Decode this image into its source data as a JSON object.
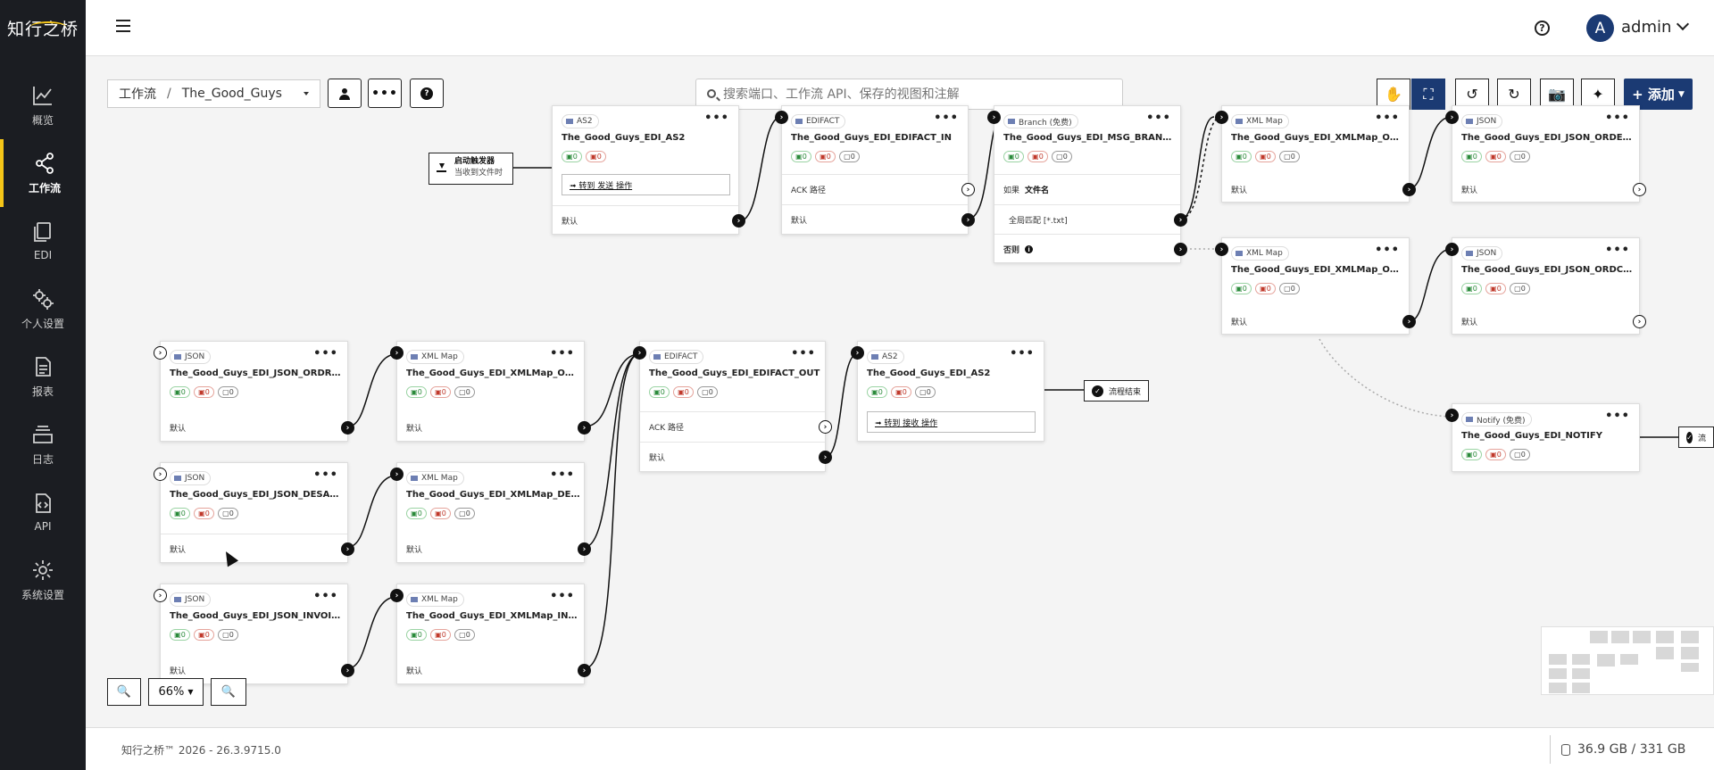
{
  "app": {
    "logo_text": "知行之桥"
  },
  "sidebar": {
    "items": [
      {
        "label": "概览",
        "icon": "chart-line-icon"
      },
      {
        "label": "工作流",
        "icon": "share-nodes-icon",
        "active": true
      },
      {
        "label": "EDI",
        "icon": "documents-icon"
      },
      {
        "label": "个人设置",
        "icon": "gears-icon"
      },
      {
        "label": "报表",
        "icon": "report-icon"
      },
      {
        "label": "日志",
        "icon": "log-stack-icon"
      },
      {
        "label": "API",
        "icon": "api-code-icon"
      },
      {
        "label": "系统设置",
        "icon": "gear-icon"
      }
    ]
  },
  "header": {
    "username": "admin",
    "avatar_letter": "A",
    "help_icon": "?"
  },
  "toolbar": {
    "breadcrumb_root": "工作流",
    "breadcrumb_sep": "/",
    "workspace": "The_Good_Guys",
    "search_placeholder": "搜索端口、工作流 API、保存的视图和注解",
    "add_label": "+ 添加"
  },
  "nodes": {
    "as2_in": {
      "type": "AS2",
      "name": "The_Good_Guys_EDI_AS2",
      "g": "0",
      "r": "0",
      "action": "➟ 转到 发送 操作",
      "row": "默认"
    },
    "edifact_in": {
      "type": "EDIFACT",
      "name": "The_Good_Guys_EDI_EDIFACT_IN",
      "g": "0",
      "r": "0",
      "k": "0",
      "row1": "ACK 路径",
      "row2": "默认"
    },
    "branch": {
      "type": "Branch (免费)",
      "name": "The_Good_Guys_EDI_MSG_BRANCH_IN",
      "g": "0",
      "r": "0",
      "k": "0",
      "if_label": "如果",
      "if_value": "文件名",
      "match": "全局匹配 [*.txt]",
      "else": "否则"
    },
    "xmlmap_orders": {
      "type": "XML Map",
      "name": "The_Good_Guys_EDI_XMLMap_ORDERS_IN",
      "g": "0",
      "r": "0",
      "k": "0",
      "row": "默认"
    },
    "json_orders": {
      "type": "JSON",
      "name": "The_Good_Guys_EDI_JSON_ORDERS_IN",
      "g": "0",
      "r": "0",
      "k": "0",
      "row": "默认"
    },
    "xmlmap_ordchg": {
      "type": "XML Map",
      "name": "The_Good_Guys_EDI_XMLMap_ORDCHG_IN",
      "g": "0",
      "r": "0",
      "k": "0",
      "row": "默认"
    },
    "json_ordchg": {
      "type": "JSON",
      "name": "The_Good_Guys_EDI_JSON_ORDCHG_IN",
      "g": "0",
      "r": "0",
      "k": "0",
      "row": "默认"
    },
    "notify": {
      "type": "Notify (免费)",
      "name": "The_Good_Guys_EDI_NOTIFY",
      "g": "0",
      "r": "0",
      "k": "0"
    },
    "json_ordrsp": {
      "type": "JSON",
      "name": "The_Good_Guys_EDI_JSON_ORDRSP_OUT",
      "g": "0",
      "r": "0",
      "k": "0",
      "row": "默认"
    },
    "xmlmap_ordrsp": {
      "type": "XML Map",
      "name": "The_Good_Guys_EDI_XMLMap_ORDRSP_O...",
      "g": "0",
      "r": "0",
      "k": "0",
      "row": "默认"
    },
    "edifact_out": {
      "type": "EDIFACT",
      "name": "The_Good_Guys_EDI_EDIFACT_OUT",
      "g": "0",
      "r": "0",
      "k": "0",
      "row1": "ACK 路径",
      "row2": "默认"
    },
    "as2_out": {
      "type": "AS2",
      "name": "The_Good_Guys_EDI_AS2",
      "g": "0",
      "r": "0",
      "k": "0",
      "action": "➟ 转到 接收 操作"
    },
    "json_desadv": {
      "type": "JSON",
      "name": "The_Good_Guys_EDI_JSON_DESADV_OUT",
      "g": "0",
      "r": "0",
      "k": "0",
      "row": "默认"
    },
    "xmlmap_desadv": {
      "type": "XML Map",
      "name": "The_Good_Guys_EDI_XMLMap_DESADV_O...",
      "g": "0",
      "r": "0",
      "k": "0",
      "row": "默认"
    },
    "json_invoic": {
      "type": "JSON",
      "name": "The_Good_Guys_EDI_JSON_INVOIC_OUT",
      "g": "0",
      "r": "0",
      "k": "0",
      "row": "默认"
    },
    "xmlmap_invoic": {
      "type": "XML Map",
      "name": "The_Good_Guys_EDI_XMLMap_INVOIC_OUT",
      "g": "0",
      "r": "0",
      "k": "0",
      "row": "默认"
    }
  },
  "trigger": {
    "title": "启动触发器",
    "desc": "当收到文件时"
  },
  "end_label": "流程结束",
  "end_label_partial": "流",
  "zoom": {
    "level": "66%"
  },
  "footer": {
    "copyright": "知行之桥™ 2026 - 26.3.9715.0",
    "storage": "36.9 GB / 331 GB"
  }
}
